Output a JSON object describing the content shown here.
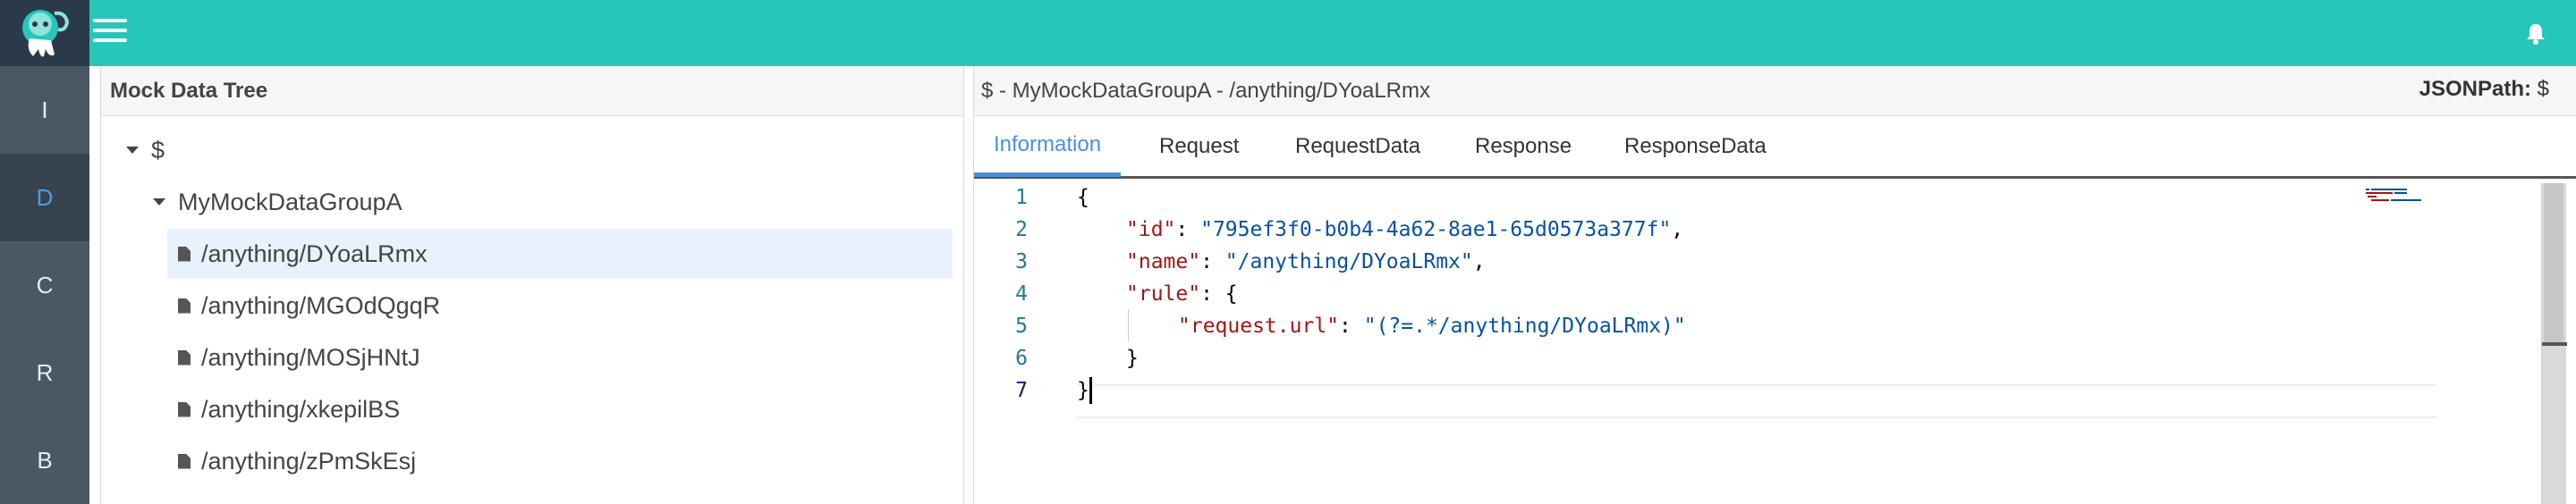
{
  "app": {
    "logo_icon": "octopus-logo-icon",
    "menu_icon": "hamburger-menu-icon",
    "notification_icon": "bell-icon"
  },
  "sidebar": {
    "items": [
      {
        "label": "I"
      },
      {
        "label": "D",
        "active": true
      },
      {
        "label": "C"
      },
      {
        "label": "R"
      },
      {
        "label": "B"
      }
    ]
  },
  "left_panel": {
    "title": "Mock Data Tree",
    "tree": [
      {
        "label": "$",
        "type": "folder",
        "expanded": true
      },
      {
        "label": "MyMockDataGroupA",
        "type": "folder",
        "expanded": true
      },
      {
        "label": "/anything/DYoaLRmx",
        "type": "file",
        "selected": true
      },
      {
        "label": "/anything/MGOdQgqR",
        "type": "file"
      },
      {
        "label": "/anything/MOSjHNtJ",
        "type": "file"
      },
      {
        "label": "/anything/xkepilBS",
        "type": "file"
      },
      {
        "label": "/anything/zPmSkEsj",
        "type": "file"
      }
    ]
  },
  "right_panel": {
    "title": "$ - MyMockDataGroupA - /anything/DYoaLRmx",
    "jsonpath_label": "JSONPath:",
    "jsonpath_value": "$",
    "tabs": [
      {
        "label": "Information",
        "active": true
      },
      {
        "label": "Request"
      },
      {
        "label": "RequestData"
      },
      {
        "label": "Response"
      },
      {
        "label": "ResponseData"
      }
    ],
    "editor": {
      "line_numbers": [
        "1",
        "2",
        "3",
        "4",
        "5",
        "6",
        "7"
      ],
      "lines": {
        "l1": "{",
        "l2_key": "\"id\"",
        "l2_colon": ": ",
        "l2_val": "\"795ef3f0-b0b4-4a62-8ae1-65d0573a377f\"",
        "l2_end": ",",
        "l3_key": "\"name\"",
        "l3_colon": ": ",
        "l3_val": "\"/anything/DYoaLRmx\"",
        "l3_end": ",",
        "l4_key": "\"rule\"",
        "l4_rest": ": {",
        "l5_key": "\"request.url\"",
        "l5_colon": ": ",
        "l5_val": "\"(?=.*/anything/DYoaLRmx)\"",
        "l6": "}",
        "l7": "}"
      }
    }
  },
  "colors": {
    "topbar": "#26c6bb",
    "sidebar": "#4a5866",
    "active_accent": "#4a90d9"
  }
}
